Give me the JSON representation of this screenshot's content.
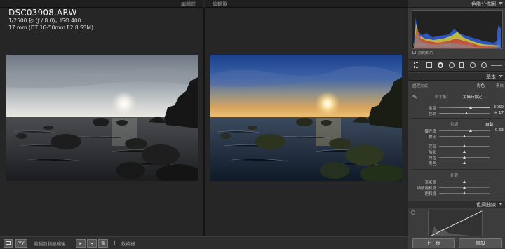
{
  "header": {
    "before_label": "編輯前",
    "after_label": "編輯後",
    "panel_title": "色階分佈圖"
  },
  "image_info": {
    "filename": "DSC03908.ARW",
    "exposure_line": "1/2500 秒 (ƒ / 8.0)，ISO 400",
    "lens_line": "17 mm (DT 16-50mm F2.8 SSM)"
  },
  "histogram": {
    "info": [
      "ISO 400",
      "17 mm",
      "ƒ / 8.0",
      "1/2500 秒"
    ],
    "original_photo_label": "原始相片"
  },
  "basic_panel": {
    "title": "基本",
    "treatment_label": "處理方式：",
    "color_tab": "彩色",
    "bw_tab": "黑白",
    "wb_label": "白平衡：",
    "wb_value": "拍攝時設定 ÷",
    "temp_label": "色溫",
    "temp_value": "5050",
    "tint_label": "色調",
    "tint_value": "+ 17",
    "tone_label": "色調",
    "auto_label": "自動",
    "exposure_label": "曝光度",
    "exposure_value": "+ 0.63",
    "contrast_label": "對比",
    "highlights_label": "亮部",
    "shadows_label": "陰影",
    "whites_label": "白色",
    "blacks_label": "黑色",
    "presence_label": "外觀",
    "clarity_label": "清晰度",
    "vibrance_label": "細節飽和度",
    "saturation_label": "飽和度"
  },
  "tone_curve": {
    "title": "色調曲線"
  },
  "toolbar": {
    "mode_label": "YY",
    "compare_label": "編輯前和編輯後：",
    "softproof_label": "軟校樣"
  },
  "buttons": {
    "prev": "上一個",
    "reset": "重設"
  },
  "slider_levels": {
    "temperature": 0.62,
    "tint": 0.54,
    "exposure": 0.62,
    "contrast": 0.5,
    "highlights": 0.5,
    "shadows": 0.5,
    "whites": 0.5,
    "blacks": 0.5,
    "clarity": 0.5,
    "vibrance": 0.5,
    "saturation": 0.5
  }
}
